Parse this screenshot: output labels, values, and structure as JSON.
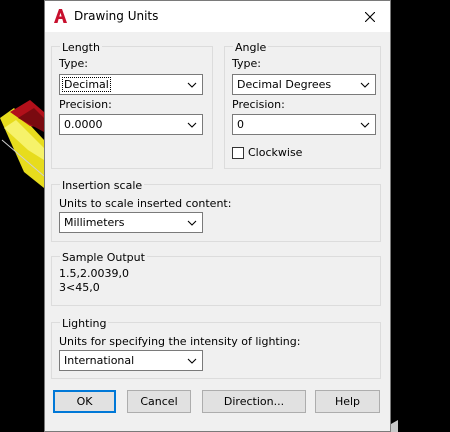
{
  "dialog": {
    "title": "Drawing Units",
    "app_icon": "autocad-a-icon",
    "close_icon": "close-icon"
  },
  "length": {
    "group_title": "Length",
    "type_label": "Type:",
    "type_value": "Decimal",
    "precision_label": "Precision:",
    "precision_value": "0.0000"
  },
  "angle": {
    "group_title": "Angle",
    "type_label": "Type:",
    "type_value": "Decimal Degrees",
    "precision_label": "Precision:",
    "precision_value": "0",
    "clockwise_label": "Clockwise",
    "clockwise_checked": false
  },
  "insertion": {
    "group_title": "Insertion scale",
    "units_label": "Units to scale inserted content:",
    "units_value": "Millimeters"
  },
  "sample": {
    "group_title": "Sample Output",
    "line1": "1.5,2.0039,0",
    "line2": "3<45,0"
  },
  "lighting": {
    "group_title": "Lighting",
    "units_label": "Units for specifying the intensity of lighting:",
    "units_value": "International"
  },
  "buttons": {
    "ok": "OK",
    "cancel": "Cancel",
    "direction": "Direction...",
    "help": "Help"
  },
  "colors": {
    "accent": "#0078d7",
    "icon_red": "#c8102e"
  }
}
